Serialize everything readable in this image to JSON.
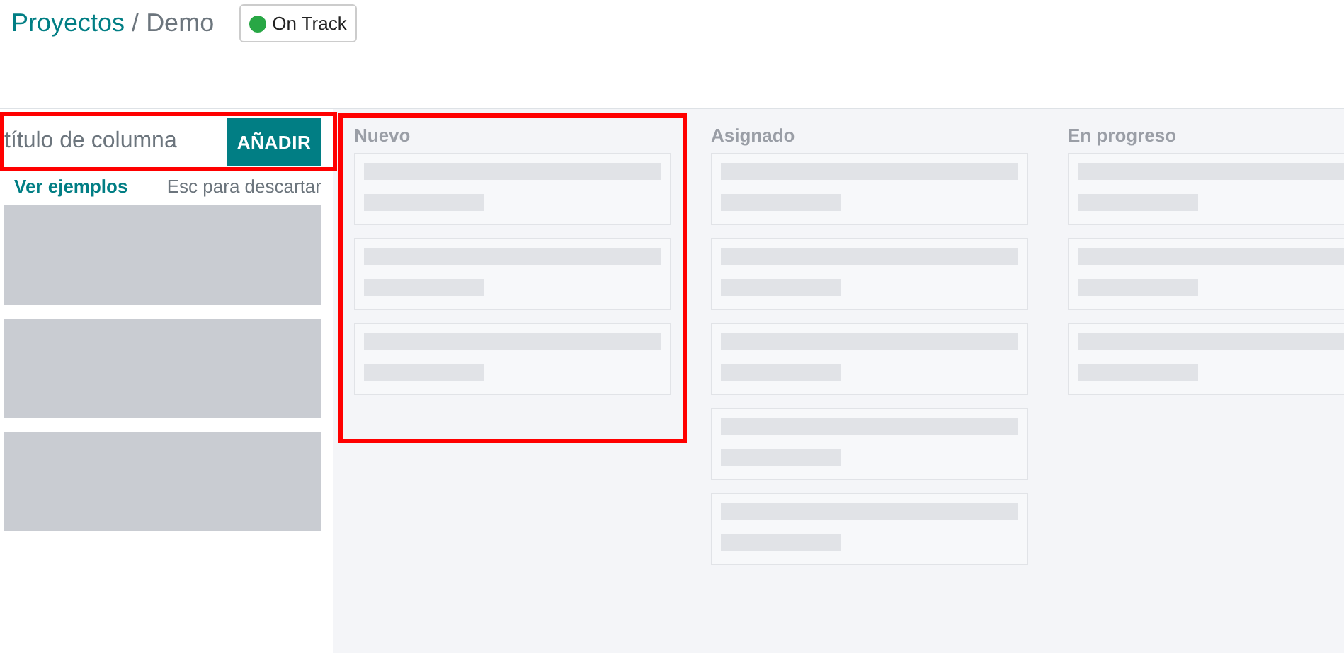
{
  "breadcrumb": {
    "parent": "Proyectos",
    "separator": "/",
    "current": "Demo"
  },
  "status": {
    "label": "On Track",
    "color": "#28a745"
  },
  "quick_create": {
    "placeholder": "título de columna",
    "button": "AÑADIR",
    "examples_link": "Ver ejemplos",
    "hint": "Esc para descartar",
    "highlighted": true,
    "preview_blocks": [
      {
        "kind": "block"
      },
      {
        "kind": "block"
      },
      {
        "kind": "block"
      }
    ]
  },
  "columns": [
    {
      "title": "Nuevo",
      "highlighted": true,
      "cards": [
        {
          "kind": "placeholder"
        },
        {
          "kind": "placeholder"
        },
        {
          "kind": "placeholder"
        }
      ]
    },
    {
      "title": "Asignado",
      "highlighted": false,
      "cards": [
        {
          "kind": "placeholder"
        },
        {
          "kind": "placeholder"
        },
        {
          "kind": "placeholder"
        },
        {
          "kind": "placeholder"
        },
        {
          "kind": "placeholder"
        }
      ]
    },
    {
      "title": "En progreso",
      "highlighted": false,
      "cards": [
        {
          "kind": "placeholder"
        },
        {
          "kind": "placeholder"
        },
        {
          "kind": "placeholder"
        }
      ]
    }
  ]
}
